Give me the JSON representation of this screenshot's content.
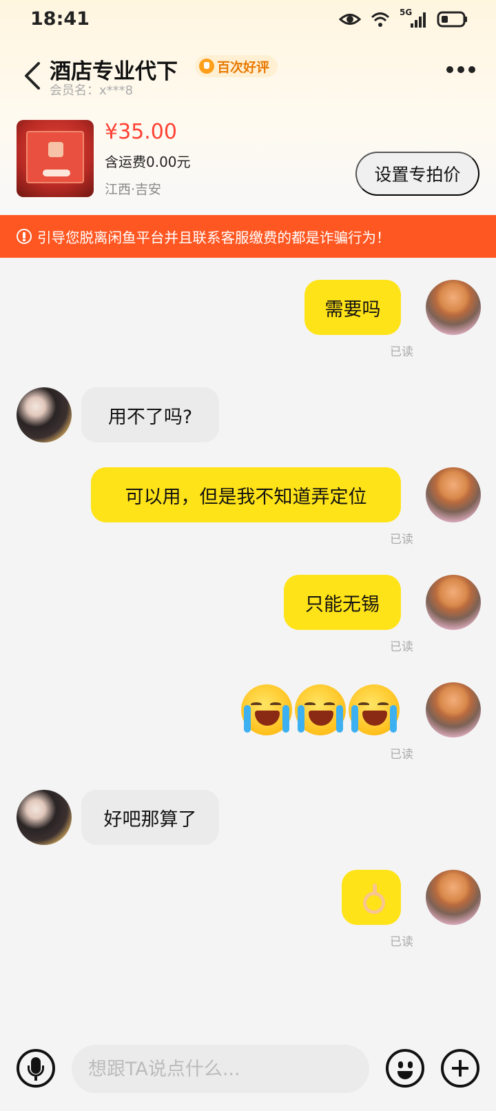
{
  "status_bar": {
    "time": "18:41",
    "network": "5G",
    "icons": [
      "eye-icon",
      "wifi-icon",
      "signal-icon",
      "battery-icon"
    ]
  },
  "header": {
    "seller_name": "酒店专业代下",
    "rating_badge": "百次好评",
    "member_name": "会员名：x***8"
  },
  "product": {
    "price": "¥35.00",
    "shipping": "含运费0.00元",
    "location": "江西·吉安",
    "set_price_button": "设置专拍价"
  },
  "warning": {
    "text": "引导您脱离闲鱼平台并且联系客服缴费的都是诈骗行为！"
  },
  "messages": [
    {
      "from": "me",
      "type": "text",
      "text": "需要吗",
      "status": "已读"
    },
    {
      "from": "them",
      "type": "text",
      "text": "用不了吗?"
    },
    {
      "from": "me",
      "type": "text",
      "text": "可以用，但是我不知道弄定位",
      "status": "已读"
    },
    {
      "from": "me",
      "type": "text",
      "text": "只能无锡",
      "status": "已读"
    },
    {
      "from": "me",
      "type": "emoji",
      "emoji": [
        "crying-laughing-emoji",
        "crying-laughing-emoji",
        "crying-laughing-emoji"
      ],
      "status": "已读"
    },
    {
      "from": "them",
      "type": "text",
      "text": "好吧那算了"
    },
    {
      "from": "me",
      "type": "emoji",
      "emoji": [
        "ok-hand-emoji"
      ],
      "status": "已读"
    }
  ],
  "input_bar": {
    "placeholder": "想跟TA说点什么..."
  },
  "colors": {
    "my_bubble": "#ffe319",
    "their_bubble": "#ebebeb",
    "warning_bg": "#ff5722",
    "price": "#ff4133"
  }
}
